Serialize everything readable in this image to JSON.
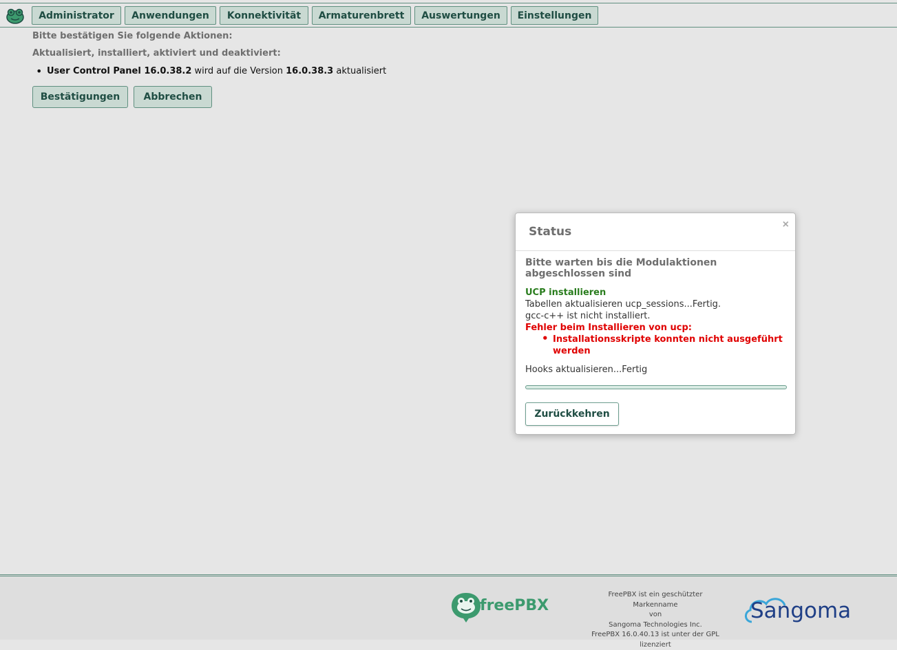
{
  "nav": {
    "items": [
      "Administrator",
      "Anwendungen",
      "Konnektivität",
      "Armaturenbrett",
      "Auswertungen",
      "Einstellungen"
    ]
  },
  "content": {
    "confirm_heading": "Bitte bestätigen Sie folgende Aktionen:",
    "actions_heading": "Aktualisiert, installiert, aktiviert und deaktiviert:",
    "update_item": {
      "module": "User Control Panel 16.0.38.2",
      "middle": " wird auf die Version ",
      "version": "16.0.38.3",
      "tail": " aktualisiert"
    },
    "confirm_button": "Bestätigungen",
    "cancel_button": "Abbrechen"
  },
  "modal": {
    "title": "Status",
    "close": "×",
    "wait_text": "Bitte warten bis die Modulaktionen abgeschlossen sind",
    "install_title": "UCP installieren",
    "log_1": "Tabellen aktualisieren ucp_sessions...Fertig.",
    "log_2": "gcc-c++ ist nicht installiert.",
    "error_title": "Fehler beim Installieren von ucp:",
    "error_item": "Installationsskripte konnten nicht ausgeführt werden",
    "hooks": "Hooks aktualisieren...Fertig",
    "progress": 1.0,
    "return_button": "Zurückkehren"
  },
  "footer": {
    "freepbx_logo": "freePBX",
    "legal_lines": [
      "FreePBX ist ein geschützter Markenname",
      "von",
      "Sangoma Technologies Inc.",
      "FreePBX 16.0.40.13 ist unter der GPL",
      "lizenziert"
    ],
    "sangoma_logo": "Sangoma"
  },
  "colors": {
    "accent": "#1f4d43",
    "button_bg": "#c9d9d2",
    "success": "#2a7d1e",
    "error": "#e00000"
  }
}
